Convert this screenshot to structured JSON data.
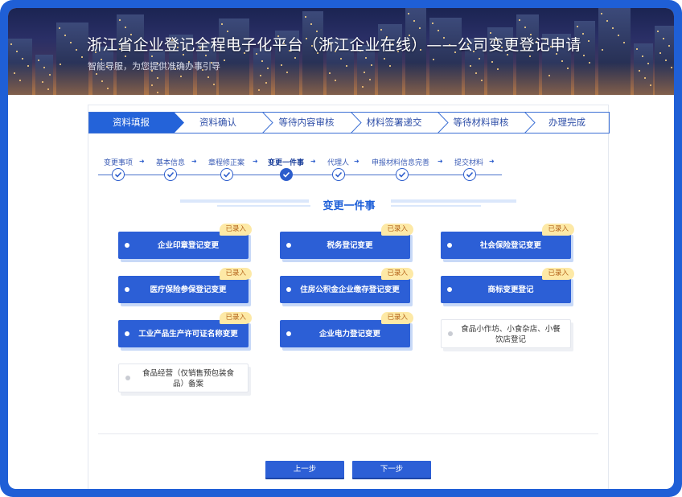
{
  "banner": {
    "title": "浙江省企业登记全程电子化平台（浙江企业在线）——公司变更登记申请",
    "subtitle": "智能导服，为您提供准确办事引导"
  },
  "steps": [
    {
      "label": "资料填报",
      "active": true
    },
    {
      "label": "资料确认",
      "active": false
    },
    {
      "label": "等待内容审核",
      "active": false
    },
    {
      "label": "材料签署递交",
      "active": false
    },
    {
      "label": "等待材料审核",
      "active": false
    },
    {
      "label": "办理完成",
      "active": false
    }
  ],
  "substeps": [
    {
      "label": "变更事项",
      "current": false
    },
    {
      "label": "基本信息",
      "current": false
    },
    {
      "label": "章程修正案",
      "current": false
    },
    {
      "label": "变更一件事",
      "current": true
    },
    {
      "label": "代理人",
      "current": false
    },
    {
      "label": "申报材料信息完善",
      "current": false
    },
    {
      "label": "提交材料",
      "current": false
    }
  ],
  "section_title": "变更一件事",
  "badge_text": "已录入",
  "items": [
    {
      "label": "企业印章登记变更",
      "done": true
    },
    {
      "label": "税务登记变更",
      "done": true
    },
    {
      "label": "社会保险登记变更",
      "done": true
    },
    {
      "label": "医疗保险参保登记变更",
      "done": true
    },
    {
      "label": "住房公积金企业缴存登记变更",
      "done": true
    },
    {
      "label": "商标变更登记",
      "done": true
    },
    {
      "label": "工业产品生产许可证名称变更",
      "done": true
    },
    {
      "label": "企业电力登记变更",
      "done": true
    },
    {
      "label": "食品小作坊、小食杂店、小餐饮店登记",
      "done": false
    },
    {
      "label": "食品经营（仅销售预包装食品）备案",
      "done": false
    }
  ],
  "buttons": {
    "prev": "上一步",
    "next": "下一步"
  },
  "colors": {
    "primary": "#2c5fd6",
    "frame": "#1f5fd6",
    "badge_bg": "#fde9a6",
    "badge_text": "#b5651d"
  }
}
